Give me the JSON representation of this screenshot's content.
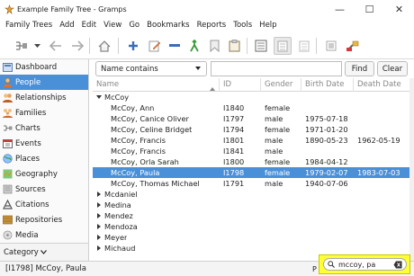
{
  "window": {
    "title": "Example Family Tree - Gramps",
    "minimize": "—",
    "maximize": "☐",
    "close": "✕"
  },
  "menubar": [
    "Family Trees",
    "Add",
    "Edit",
    "View",
    "Go",
    "Bookmarks",
    "Reports",
    "Tools",
    "Help"
  ],
  "sidebar": {
    "items": [
      {
        "label": "Dashboard",
        "icon": "dashboard-icon"
      },
      {
        "label": "People",
        "icon": "people-icon",
        "selected": true
      },
      {
        "label": "Relationships",
        "icon": "relationships-icon"
      },
      {
        "label": "Families",
        "icon": "families-icon"
      },
      {
        "label": "Charts",
        "icon": "charts-icon"
      },
      {
        "label": "Events",
        "icon": "events-icon"
      },
      {
        "label": "Places",
        "icon": "places-icon"
      },
      {
        "label": "Geography",
        "icon": "geography-icon"
      },
      {
        "label": "Sources",
        "icon": "sources-icon"
      },
      {
        "label": "Citations",
        "icon": "citations-icon"
      },
      {
        "label": "Repositories",
        "icon": "repositories-icon"
      },
      {
        "label": "Media",
        "icon": "media-icon"
      }
    ],
    "category_label": "Category"
  },
  "filter": {
    "selector": "Name contains",
    "value": "",
    "find_label": "Find",
    "clear_label": "Clear"
  },
  "table": {
    "columns": [
      "Name",
      "ID",
      "Gender",
      "Birth Date",
      "Death Date"
    ],
    "group": "McCoy",
    "rows": [
      {
        "name": "McCoy, Ann",
        "id": "I1840",
        "gender": "female",
        "birth": "",
        "death": ""
      },
      {
        "name": "McCoy, Canice Oliver",
        "id": "I1797",
        "gender": "male",
        "birth": "1975-07-18",
        "death": ""
      },
      {
        "name": "McCoy, Celine Bridget",
        "id": "I1794",
        "gender": "female",
        "birth": "1971-01-20",
        "death": ""
      },
      {
        "name": "McCoy, Francis",
        "id": "I1801",
        "gender": "male",
        "birth": "1890-05-23",
        "death": "1962-05-19"
      },
      {
        "name": "McCoy, Francis",
        "id": "I1841",
        "gender": "male",
        "birth": "",
        "death": ""
      },
      {
        "name": "McCoy, Orla Sarah",
        "id": "I1800",
        "gender": "female",
        "birth": "1984-04-12",
        "death": ""
      },
      {
        "name": "McCoy, Paula",
        "id": "I1798",
        "gender": "female",
        "birth": "1979-02-07",
        "death": "1983-07-03",
        "selected": true
      },
      {
        "name": "McCoy, Thomas Michael",
        "id": "I1791",
        "gender": "male",
        "birth": "1940-07-06",
        "death": ""
      }
    ],
    "collapsed_groups": [
      "Mcdaniel",
      "Medina",
      "Mendez",
      "Mendoza",
      "Meyer",
      "Michaud"
    ]
  },
  "status": {
    "text": "[I1798] McCoy, Paula",
    "prefix": "P"
  },
  "search": {
    "value": "mccoy, pa",
    "highlight_color": "#ffff33"
  },
  "colors": {
    "selection": "#4a90d9"
  }
}
